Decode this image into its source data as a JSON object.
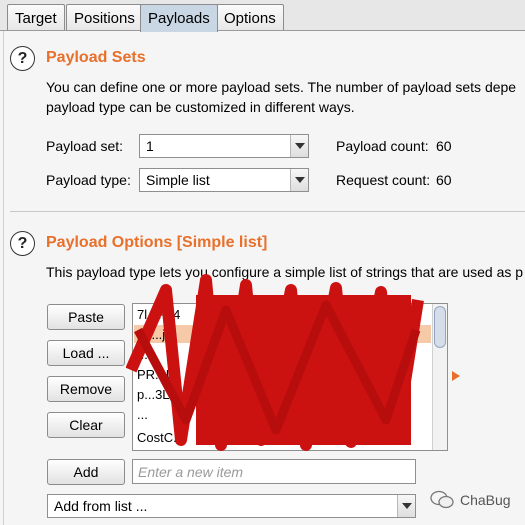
{
  "tabs": [
    {
      "label": "Target"
    },
    {
      "label": "Positions"
    },
    {
      "label": "Payloads",
      "active": true
    },
    {
      "label": "Options"
    }
  ],
  "payload_sets": {
    "title": "Payload Sets",
    "description_line1": "You can define one or more payload sets. The number of payload sets depe",
    "description_line2": "payload type can be customized in different ways.",
    "set_label": "Payload set:",
    "set_value": "1",
    "type_label": "Payload type:",
    "type_value": "Simple list",
    "payload_count_label": "Payload count:",
    "payload_count": "60",
    "request_count_label": "Request count:",
    "request_count": "60"
  },
  "payload_options": {
    "title": "Payload Options [Simple list]",
    "description": "This payload type lets you configure a simple list of strings that are used as p",
    "buttons": {
      "paste": "Paste",
      "load": "Load ...",
      "remove": "Remove",
      "clear": "Clear",
      "add": "Add"
    },
    "list_items": [
      "7l...Px4",
      "o8...jo",
      "...",
      "PR...U",
      "p...3Lck",
      "...",
      "CostC..."
    ],
    "new_item_placeholder": "Enter a new item",
    "add_from_list": "Add from list ..."
  },
  "watermark": "ChaBug",
  "colors": {
    "accent": "#e8702a",
    "selected_tab": "#c9d6e4",
    "redaction": "#cc1111"
  }
}
